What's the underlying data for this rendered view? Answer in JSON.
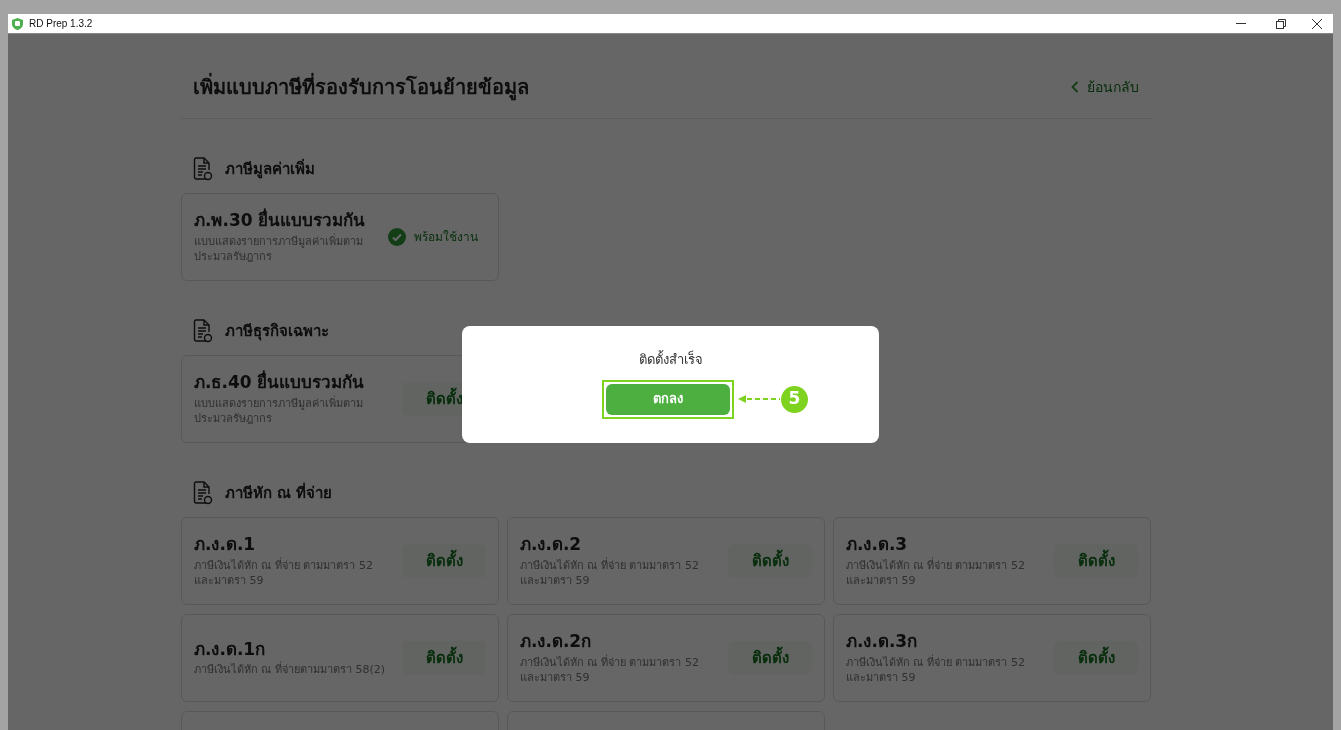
{
  "window": {
    "title": "RD Prep 1.3.2"
  },
  "page": {
    "title": "เพิ่มแบบภาษีที่รองรับการโอนย้ายข้อมูล",
    "back_link": "ย้อนกลับ"
  },
  "sections": [
    {
      "heading": "ภาษีมูลค่าเพิ่ม",
      "cards": [
        {
          "kind": "ready",
          "title": "ภ.พ.30 ยื่นแบบรวมกัน",
          "description": "แบบแสดงรายการภาษีมูลค่าเพิ่มตามประมวลรัษฎากร",
          "action": "พร้อมใช้งาน"
        }
      ]
    },
    {
      "heading": "ภาษีธุรกิจเฉพาะ",
      "cards": [
        {
          "kind": "install",
          "title": "ภ.ธ.40 ยื่นแบบรวมกัน",
          "description": "แบบแสดงรายการภาษีมูลค่าเพิ่มตามประมวลรัษฎากร",
          "action": "ติดตั้ง"
        }
      ]
    },
    {
      "heading": "ภาษีหัก ณ ที่จ่าย",
      "cards": [
        {
          "kind": "install",
          "title": "ภ.ง.ด.1",
          "description": "ภาษีเงินได้หัก ณ ที่จ่าย ตามมาตรา 52 และมาตรา 59",
          "action": "ติดตั้ง"
        },
        {
          "kind": "install",
          "title": "ภ.ง.ด.2",
          "description": "ภาษีเงินได้หัก ณ ที่จ่าย ตามมาตรา 52 และมาตรา 59",
          "action": "ติดตั้ง"
        },
        {
          "kind": "install",
          "title": "ภ.ง.ด.3",
          "description": "ภาษีเงินได้หัก ณ ที่จ่าย ตามมาตรา 52 และมาตรา 59",
          "action": "ติดตั้ง"
        },
        {
          "kind": "install",
          "title": "ภ.ง.ด.1ก",
          "description": "ภาษีเงินได้หัก ณ ที่จ่ายตามมาตรา 58(2)",
          "action": "ติดตั้ง"
        },
        {
          "kind": "install",
          "title": "ภ.ง.ด.2ก",
          "description": "ภาษีเงินได้หัก ณ ที่จ่าย ตามมาตรา 52 และมาตรา 59",
          "action": "ติดตั้ง"
        },
        {
          "kind": "install",
          "title": "ภ.ง.ด.3ก",
          "description": "ภาษีเงินได้หัก ณ ที่จ่าย ตามมาตรา 52 และมาตรา 59",
          "action": "ติดตั้ง"
        },
        {
          "kind": "cut"
        },
        {
          "kind": "cut"
        }
      ]
    }
  ],
  "dialog": {
    "message": "ติดตั้งสำเร็จ",
    "button": "ตกลง",
    "step_marker": "5"
  }
}
